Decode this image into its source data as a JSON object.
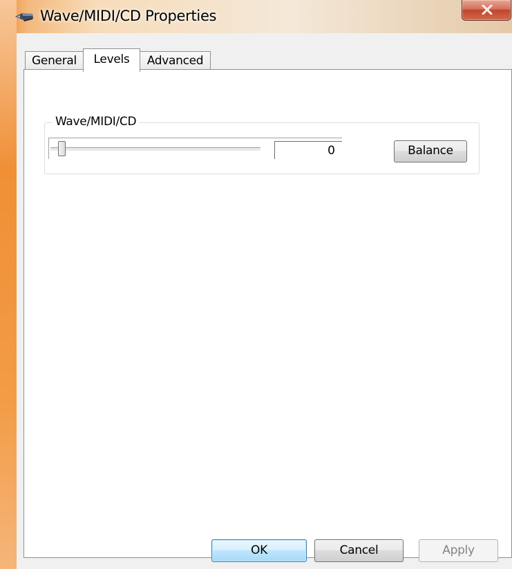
{
  "window": {
    "title": "Wave/MIDI/CD Properties",
    "title_icon": "speaker-device-icon",
    "close_icon": "close-icon"
  },
  "tabs": [
    {
      "label": "General",
      "selected": false
    },
    {
      "label": "Levels",
      "selected": true
    },
    {
      "label": "Advanced",
      "selected": false
    }
  ],
  "levels": {
    "group_label": "Wave/MIDI/CD",
    "slider_level": 0,
    "value": "0",
    "balance_label": "Balance"
  },
  "buttons": {
    "ok": "OK",
    "cancel": "Cancel",
    "apply": "Apply"
  },
  "colors": {
    "frame_accent": "#f08f36",
    "close_button": "#c1452c",
    "default_button_border": "#3c7fb1"
  }
}
